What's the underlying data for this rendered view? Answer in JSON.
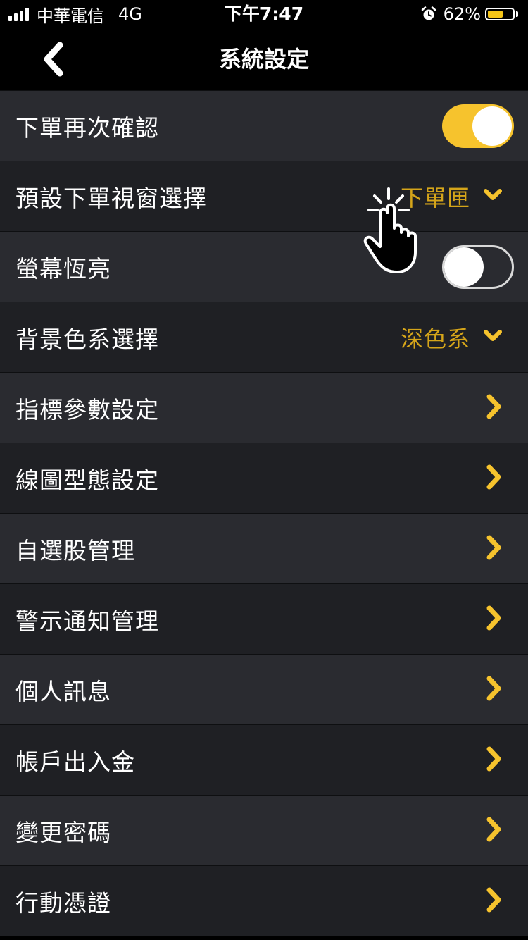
{
  "status_bar": {
    "carrier": "中華電信",
    "network": "4G",
    "time": "下午7:47",
    "battery_percent": "62%",
    "battery_level": 0.62
  },
  "nav": {
    "title": "系統設定"
  },
  "colors": {
    "accent": "#f6c32d",
    "value_text": "#d5a51a"
  },
  "settings": [
    {
      "label": "下單再次確認",
      "type": "toggle",
      "on": true
    },
    {
      "label": "預設下單視窗選擇",
      "type": "select",
      "value": "下單匣"
    },
    {
      "label": "螢幕恆亮",
      "type": "toggle",
      "on": false
    },
    {
      "label": "背景色系選擇",
      "type": "select",
      "value": "深色系"
    },
    {
      "label": "指標參數設定",
      "type": "link"
    },
    {
      "label": "線圖型態設定",
      "type": "link"
    },
    {
      "label": "自選股管理",
      "type": "link"
    },
    {
      "label": "警示通知管理",
      "type": "link"
    },
    {
      "label": "個人訊息",
      "type": "link"
    },
    {
      "label": "帳戶出入金",
      "type": "link"
    },
    {
      "label": "變更密碼",
      "type": "link"
    },
    {
      "label": "行動憑證",
      "type": "link"
    }
  ]
}
